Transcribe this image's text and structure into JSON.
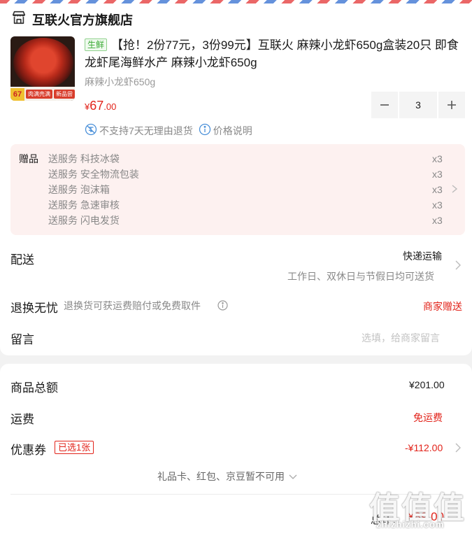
{
  "shop": {
    "name": "互联火官方旗舰店",
    "icon": "store-icon"
  },
  "product": {
    "image_badge": "67",
    "image_tags": [
      "肉满壳满",
      "新品尝鲜"
    ],
    "fresh_tag": "生鲜",
    "title": "【抢！2份77元，3份99元】互联火 麻辣小龙虾650g盒装20只 即食龙虾尾海鲜水产 麻辣小龙虾650g",
    "spec": "麻辣小龙虾650g",
    "price_symbol": "¥",
    "price_int": "67",
    "price_dec": ".00",
    "quantity": "3"
  },
  "notices": {
    "no_return": "不支持7天无理由退货",
    "price_info": "价格说明"
  },
  "gift": {
    "label": "赠品",
    "items": [
      {
        "name": "送服务 科技冰袋",
        "qty": "x3"
      },
      {
        "name": "送服务 安全物流包装",
        "qty": "x3"
      },
      {
        "name": "送服务 泡沫箱",
        "qty": "x3"
      },
      {
        "name": "送服务 急速审核",
        "qty": "x3"
      },
      {
        "name": "送服务 闪电发货",
        "qty": "x3"
      }
    ]
  },
  "delivery": {
    "label": "配送",
    "method": "快递运输",
    "note": "工作日、双休日与节假日均可送货"
  },
  "returns": {
    "label": "退换无忧",
    "desc": "退换货可获运费赔付或免费取件",
    "status": "商家赠送"
  },
  "message": {
    "label": "留言",
    "placeholder": "选填，给商家留言"
  },
  "summary": {
    "total_label": "商品总额",
    "total_value": "¥201.00",
    "shipping_label": "运费",
    "shipping_value": "免运费",
    "coupon_label": "优惠券",
    "coupon_tag": "已选1张",
    "coupon_value": "-¥112.00",
    "unavailable": "礼品卡、红包、京豆暂不可用",
    "grand_label": "总计：",
    "grand_value": "¥89.00"
  },
  "watermark": {
    "glyphs": "值值值",
    "site": "zhizhizhi.com"
  },
  "colors": {
    "accent_red": "#e2231a",
    "fresh_green": "#3aaa35",
    "gift_bg": "#fdf1f0"
  }
}
